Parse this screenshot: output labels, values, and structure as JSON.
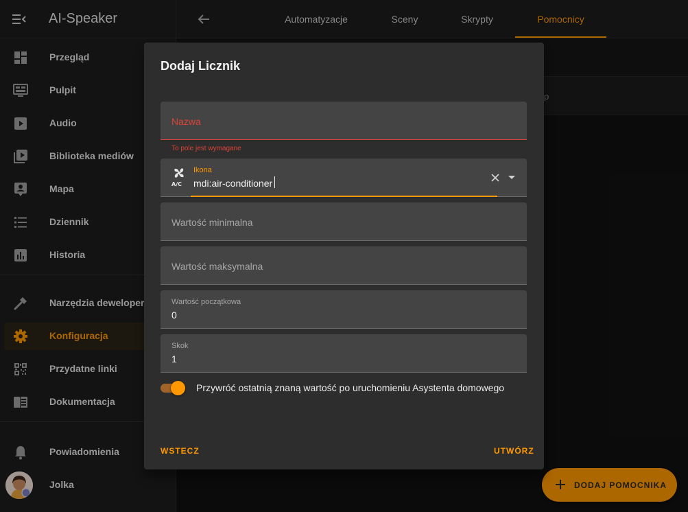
{
  "app": {
    "title": "AI-Speaker",
    "accent": "#ff9800"
  },
  "sidebar": {
    "items": [
      {
        "label": "Przegląd",
        "icon": "dashboard-icon"
      },
      {
        "label": "Pulpit",
        "icon": "monitor-dashboard-icon"
      },
      {
        "label": "Audio",
        "icon": "play-box-icon"
      },
      {
        "label": "Biblioteka mediów",
        "icon": "play-box-multiple-icon"
      },
      {
        "label": "Mapa",
        "icon": "account-box-icon"
      },
      {
        "label": "Dziennik",
        "icon": "format-list-bulleted-icon"
      },
      {
        "label": "Historia",
        "icon": "chart-box-icon"
      },
      {
        "label": "Narzędzia dewelopera",
        "icon": "hammer-icon"
      },
      {
        "label": "Konfiguracja",
        "icon": "cog-icon",
        "active": true
      },
      {
        "label": "Przydatne linki",
        "icon": "qrcode-icon"
      },
      {
        "label": "Dokumentacja",
        "icon": "book-open-icon"
      },
      {
        "label": "Powiadomienia",
        "icon": "bell-icon"
      },
      {
        "label": "Jolka",
        "icon": "avatar"
      }
    ]
  },
  "tabs": [
    {
      "label": "Automatyzacje"
    },
    {
      "label": "Sceny"
    },
    {
      "label": "Skrypty"
    },
    {
      "label": "Pomocnicy",
      "active": true
    }
  ],
  "background": {
    "row_text": "p"
  },
  "dialog": {
    "title": "Dodaj Licznik",
    "name_field": {
      "label": "Nazwa",
      "error": "To pole jest wymagane"
    },
    "icon_field": {
      "label": "Ikona",
      "value": "mdi:air-conditioner"
    },
    "min_field": {
      "label": "Wartość minimalna"
    },
    "max_field": {
      "label": "Wartość maksymalna"
    },
    "initial_field": {
      "label": "Wartość początkowa",
      "value": "0"
    },
    "step_field": {
      "label": "Skok",
      "value": "1"
    },
    "restore_switch": {
      "label": "Przywróć ostatnią znaną wartość po uruchomieniu Asystenta domowego",
      "checked": true
    },
    "back_button": "WSTECZ",
    "create_button": "UTWÓRZ"
  },
  "fab": {
    "label": "DODAJ POMOCNIKA"
  }
}
